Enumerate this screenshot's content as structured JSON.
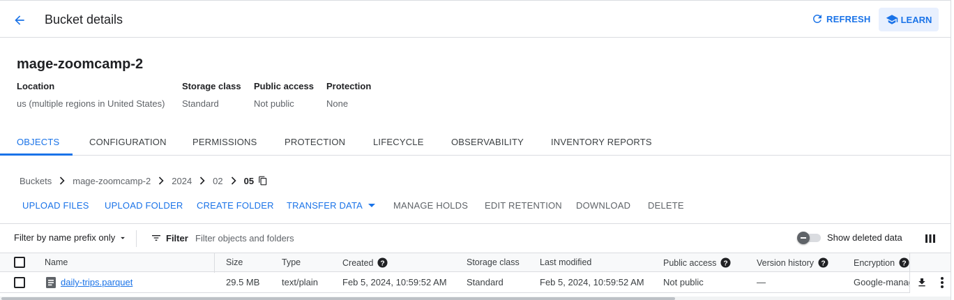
{
  "header": {
    "title": "Bucket details",
    "refresh_label": "REFRESH",
    "learn_label": "LEARN"
  },
  "bucket": {
    "name": "mage-zoomcamp-2",
    "meta": [
      {
        "label": "Location",
        "value": "us (multiple regions in United States)"
      },
      {
        "label": "Storage class",
        "value": "Standard"
      },
      {
        "label": "Public access",
        "value": "Not public"
      },
      {
        "label": "Protection",
        "value": "None"
      }
    ]
  },
  "tabs": [
    {
      "label": "OBJECTS",
      "active": true
    },
    {
      "label": "CONFIGURATION"
    },
    {
      "label": "PERMISSIONS"
    },
    {
      "label": "PROTECTION"
    },
    {
      "label": "LIFECYCLE"
    },
    {
      "label": "OBSERVABILITY"
    },
    {
      "label": "INVENTORY REPORTS"
    }
  ],
  "breadcrumb": [
    "Buckets",
    "mage-zoomcamp-2",
    "2024",
    "02",
    "05"
  ],
  "actions": {
    "upload_files": "UPLOAD FILES",
    "upload_folder": "UPLOAD FOLDER",
    "create_folder": "CREATE FOLDER",
    "transfer_data": "TRANSFER DATA",
    "manage_holds": "MANAGE HOLDS",
    "edit_retention": "EDIT RETENTION",
    "download": "DOWNLOAD",
    "delete": "DELETE"
  },
  "filter": {
    "prefix_select": "Filter by name prefix only",
    "filter_label": "Filter",
    "placeholder": "Filter objects and folders",
    "show_deleted_label": "Show deleted data",
    "show_deleted": false
  },
  "table": {
    "columns": [
      "Name",
      "Size",
      "Type",
      "Created",
      "Storage class",
      "Last modified",
      "Public access",
      "Version history",
      "Encryption"
    ],
    "rows": [
      {
        "name": "daily-trips.parquet",
        "size": "29.5 MB",
        "type": "text/plain",
        "created": "Feb 5, 2024, 10:59:52 AM",
        "storage_class": "Standard",
        "last_modified": "Feb 5, 2024, 10:59:52 AM",
        "public_access": "Not public",
        "version_history": "—",
        "encryption": "Google-managed"
      }
    ]
  },
  "colors": {
    "accent": "#1a73e8",
    "learn_bg": "#e8f0fe",
    "divider": "#dadce0",
    "muted": "#5f6368"
  }
}
